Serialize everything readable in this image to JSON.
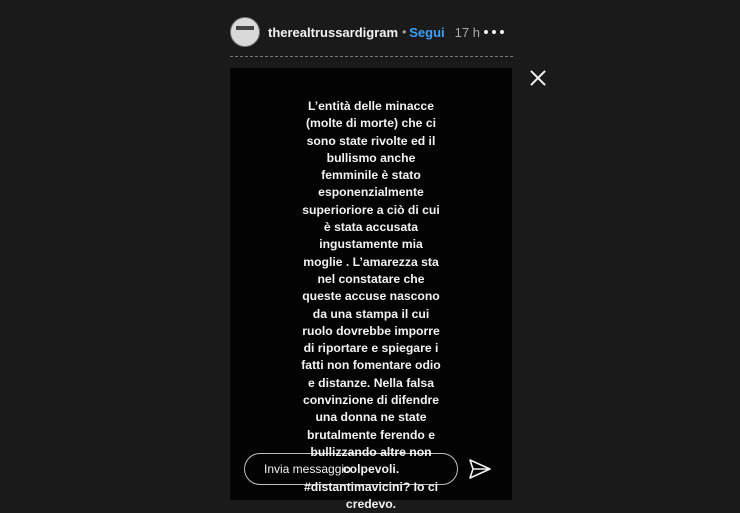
{
  "header": {
    "username": "therealtrussardigram",
    "separator": "•",
    "follow_label": "Segui",
    "time": "17 h"
  },
  "story": {
    "text": "L’entità delle minacce\n(molte di morte) che ci\nsono state rivolte ed il\nbullismo anche\nfemminile è stato\nesponenzialmente\nsuperioriore a ciò di cui\nè stata accusata\ningustamente mia\nmoglie . L’amarezza sta\nnel constatare che\nqueste accuse nascono\nda una stampa il cui\nruolo dovrebbe imporre\ndi riportare e spiegare i\nfatti non fomentare odio\ne distanze. Nella falsa\nconvinzione di difendre\nuna donna ne state\nbrutalmente ferendo e\nbullizzando altre non\ncolpevoli.\n#distantimavicini? Io ci\ncredevo."
  },
  "reply": {
    "placeholder": "Invia messaggio"
  },
  "icons": {
    "more": "more-options-icon",
    "close": "close-icon",
    "send": "send-icon"
  }
}
